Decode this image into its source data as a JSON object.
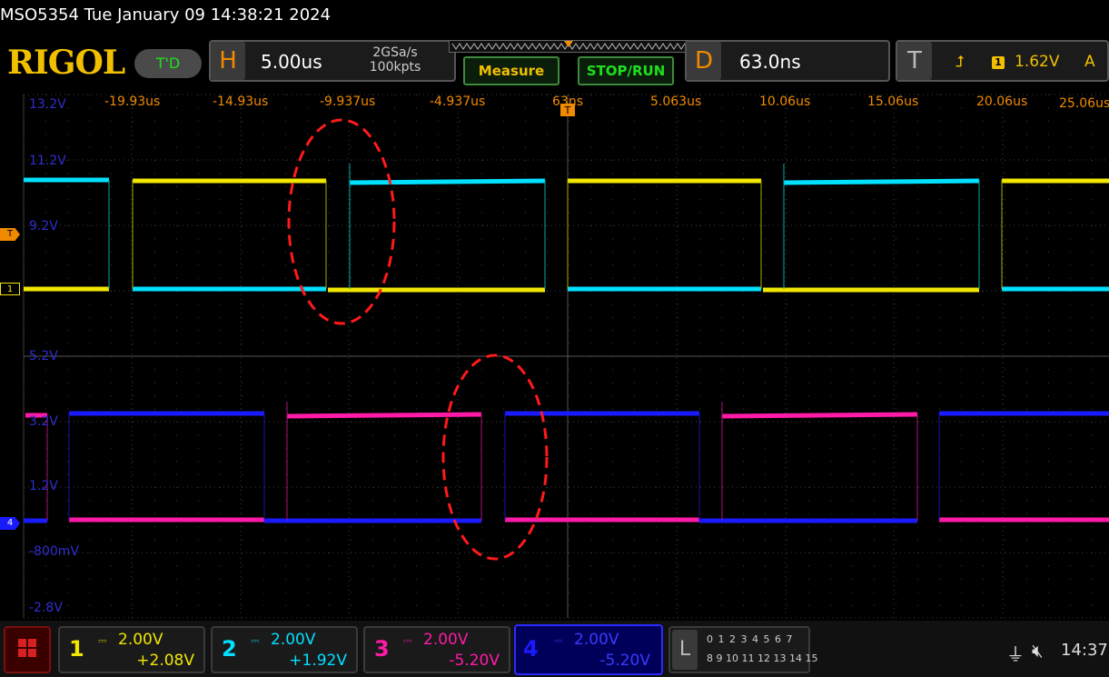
{
  "title": "MSO5354  Tue January 09 14:38:21 2024",
  "brand": "RIGOL",
  "run_status": "T'D",
  "horizontal": {
    "letter": "H",
    "timebase": "5.00us",
    "sample_rate": "2GSa/s",
    "memory_depth": "100kpts"
  },
  "buttons": {
    "measure": "Measure",
    "stop_run": "STOP/RUN"
  },
  "delay": {
    "letter": "D",
    "value": "63.0ns"
  },
  "trigger": {
    "letter": "T",
    "source": "1",
    "level": "1.62V",
    "mode": "A"
  },
  "time_labels": [
    "-19.93us",
    "-14.93us",
    "-9.937us",
    "-4.937us",
    "63ns",
    "5.063us",
    "10.06us",
    "15.06us",
    "20.06us",
    "25.06us"
  ],
  "volt_labels": [
    "13.2V",
    "11.2V",
    "9.2V",
    "5.2V",
    "3.2V",
    "1.2V",
    "-800mV",
    "-2.8V"
  ],
  "channels": [
    {
      "num": "1",
      "scale": "2.00V",
      "offset": "+2.08V",
      "color": "#f0e600"
    },
    {
      "num": "2",
      "scale": "2.00V",
      "offset": "+1.92V",
      "color": "#00e0ff"
    },
    {
      "num": "3",
      "scale": "2.00V",
      "offset": "-5.20V",
      "color": "#ff1aa8"
    },
    {
      "num": "4",
      "scale": "2.00V",
      "offset": "-5.20V",
      "color": "#1a1aff"
    }
  ],
  "logic": {
    "letter": "L",
    "row1": "0 1 2 3   4 5 6 7",
    "row2": "8 9 10 11 12 13 14 15"
  },
  "markers": {
    "trigger": "T",
    "ch1": "1",
    "ch4": "4"
  },
  "clock": "14:37",
  "icons": {
    "usb": "usb-icon",
    "mute": "speaker-mute-icon",
    "menu": "menu-grid-icon",
    "trigger_edge": "rising-edge-icon"
  }
}
